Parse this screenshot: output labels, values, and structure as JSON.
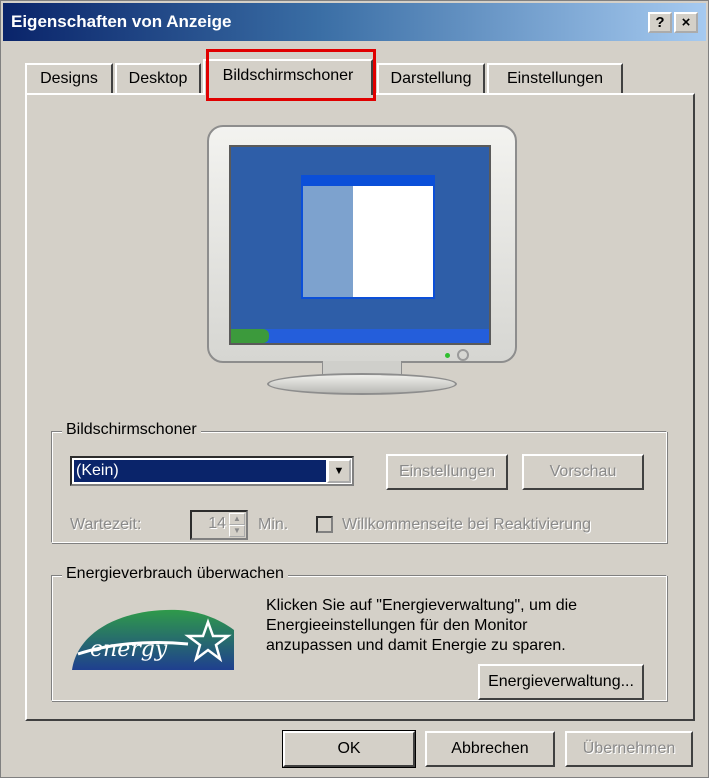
{
  "window": {
    "title": "Eigenschaften von Anzeige",
    "help_glyph": "?",
    "close_glyph": "×"
  },
  "tabs": [
    {
      "label": "Designs",
      "active": false
    },
    {
      "label": "Desktop",
      "active": false
    },
    {
      "label": "Bildschirmschoner",
      "active": true,
      "highlighted": true
    },
    {
      "label": "Darstellung",
      "active": false
    },
    {
      "label": "Einstellungen",
      "active": false
    }
  ],
  "screensaver": {
    "group_label": "Bildschirmschoner",
    "selected": "(Kein)",
    "settings_button": "Einstellungen",
    "preview_button": "Vorschau",
    "wait_label": "Wartezeit:",
    "wait_value": "14",
    "wait_unit": "Min.",
    "welcome_checkbox_label": "Willkommenseite bei Reaktivierung",
    "welcome_checked": false
  },
  "energy": {
    "group_label": "Energieverbrauch überwachen",
    "logo_text": "energy",
    "description_line1": "Klicken Sie auf \"Energieverwaltung\", um die",
    "description_line2": "Energieeinstellungen für den Monitor",
    "description_line3": "anzupassen und damit Energie zu sparen.",
    "power_button": "Energieverwaltung..."
  },
  "footer": {
    "ok": "OK",
    "cancel": "Abbrechen",
    "apply": "Übernehmen"
  },
  "colors": {
    "highlight_box": "#e00000",
    "title_gradient_start": "#0a246a",
    "dialog_face": "#d4d0c8"
  }
}
